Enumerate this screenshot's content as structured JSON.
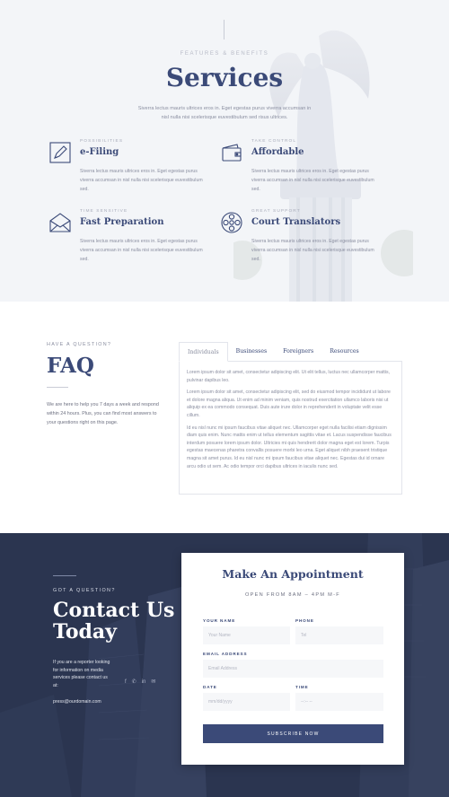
{
  "services": {
    "eyebrow": "FEATURES & BENEFITS",
    "title": "Services",
    "intro": "Siverra lectus mauris ultrices eros in. Eget egestas purus viverra accumsan in nisl nulla nisi scelerisque euvestibulum sed risus ultrices.",
    "features": [
      {
        "icon": "pencil-paper-icon",
        "kicker": "POSSIBILITIES",
        "name": "e-Filing",
        "desc": "Siverra lectus mauris ultrices eros in. Eget egestas purus viverra accumsan in nisl nulla nisi scelerisque euvestibulum sed."
      },
      {
        "icon": "wallet-icon",
        "kicker": "TAKE CONTROL",
        "name": "Affordable",
        "desc": "Siverra lectus mauris ultrices eros in. Eget egestas purus viverra accumsan in nisl nulla nisi scelerisque euvestibulum sed."
      },
      {
        "icon": "envelope-icon",
        "kicker": "TIME SENSITIVE",
        "name": "Fast Preparation",
        "desc": "Siverra lectus mauris ultrices eros in. Eget egestas purus viverra accumsan in nisl nulla nisi scelerisque euvestibulum sed."
      },
      {
        "icon": "film-reel-icon",
        "kicker": "GREAT SUPPORT",
        "name": "Court Translators",
        "desc": "Siverra lectus mauris ultrices eros in. Eget egestas purus viverra accumsan in nisl nulla nisi scelerisque euvestibulum sed."
      }
    ]
  },
  "faq": {
    "eyebrow": "HAVE A QUESTION?",
    "title": "FAQ",
    "lead": "We are here to help you 7 days a week and respond within 24 hours. Plus, you can find most answers to your questions right on this page.",
    "tabs": [
      "Individuals",
      "Businesses",
      "Foreigners",
      "Resources"
    ],
    "active_tab": "Individuals",
    "paragraphs": [
      "Lorem ipsum dolor sit amet, consectetur adipiscing elit. Ut elit tellus, luctus nec ullamcorper mattis, pulvinar dapibus leo.",
      "Lorem ipsum dolor sit amet, consectetur adipiscing elit, sed do eiusmod tempor incididunt ut labore et dolore magna aliqua. Ut enim ad minim veniam, quis nostrud exercitation ullamco laboris nisi ut aliquip ex ea commodo consequat. Duis aute irure dolor in reprehenderit in voluptate velit esse cillum.",
      "Id eu nisl nunc mi ipsum faucibus vitae aliquet nec. Ullamcorper eget nulla facilisi etiam dignissim diam quis enim. Nunc mattis enim ut tellus elementum sagittis vitae et. Lacus suspendisse faucibus interdum posuere lorem ipsum dolor. Ultricies mi quis hendrerit dolor magna eget est lorem. Turpis egestas maecenas pharetra convallis posuere morbi leo urna. Eget aliquet nibh praesent tristique magna sit amet purus. Id eu nisl nunc mi ipsum faucibus vitae aliquet nec. Egestas dui id ornare arcu odio ut sem. Ac odio tempor orci dapibus ultrices in iaculis nunc sed."
    ]
  },
  "contact": {
    "eyebrow": "GOT A QUESTION?",
    "title": "Contact Us Today",
    "blurb": "If you are a reporter looking for information on media services please contact us at:",
    "email": "press@ourdomain.com",
    "socials": [
      "f",
      "✆",
      "in",
      "✉"
    ]
  },
  "form": {
    "title": "Make An Appointment",
    "subtitle": "OPEN FROM 8AM – 4PM M-F",
    "fields": {
      "name": {
        "label": "YOUR NAME",
        "placeholder": "Your Name"
      },
      "phone": {
        "label": "PHONE",
        "placeholder": "Tel"
      },
      "email": {
        "label": "EMAIL ADDRESS",
        "placeholder": "Email Address"
      },
      "date": {
        "label": "DATE",
        "placeholder": "mm/dd/yyyy"
      },
      "time": {
        "label": "TIME",
        "placeholder": "--:-- --"
      }
    },
    "submit_label": "SUBSCRIBE NOW"
  },
  "colors": {
    "brand": "#3b4a78",
    "dark_bg": "#2b3550",
    "muted": "#8a8ea0"
  }
}
